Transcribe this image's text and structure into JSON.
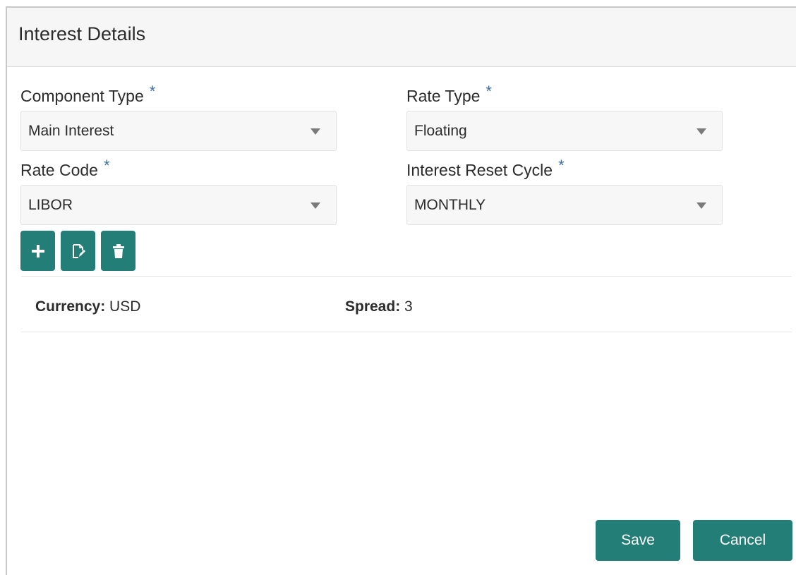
{
  "dialog": {
    "title": "Interest Details"
  },
  "form": {
    "component_type": {
      "label": "Component Type",
      "required_mark": "*",
      "value": "Main Interest"
    },
    "rate_type": {
      "label": "Rate Type",
      "required_mark": "*",
      "value": "Floating"
    },
    "rate_code": {
      "label": "Rate Code",
      "required_mark": "*",
      "value": "LIBOR"
    },
    "interest_reset_cycle": {
      "label": "Interest Reset Cycle",
      "required_mark": "*",
      "value": "MONTHLY"
    }
  },
  "toolbar": {
    "buttons": [
      {
        "icon": "plus-icon"
      },
      {
        "icon": "edit-document-icon"
      },
      {
        "icon": "trash-icon"
      }
    ]
  },
  "summary": {
    "currency_label": "Currency:",
    "currency_value": "USD",
    "spread_label": "Spread:",
    "spread_value": "3"
  },
  "footer": {
    "save_label": "Save",
    "cancel_label": "Cancel"
  },
  "colors": {
    "accent": "#247e78",
    "required": "#3a6ea5",
    "header_bg": "#f6f6f6"
  }
}
